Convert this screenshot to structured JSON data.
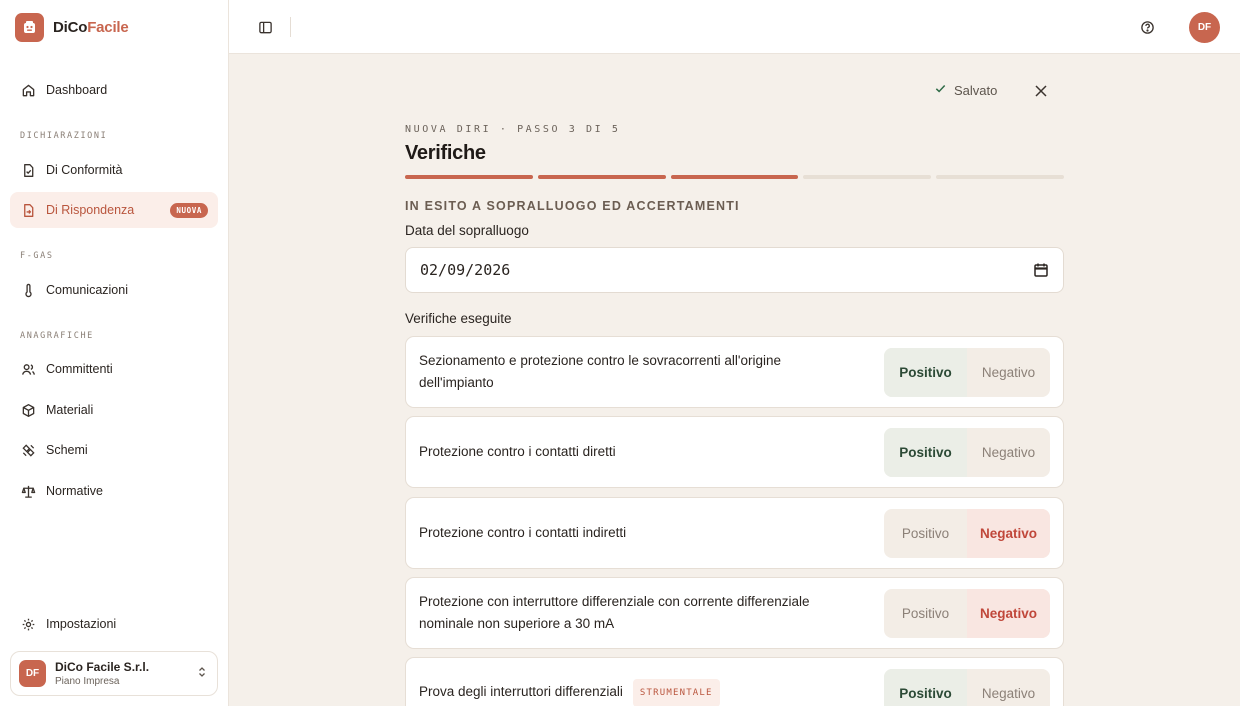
{
  "app": {
    "brand_part1": "DiCo",
    "brand_part2": "Facile",
    "accent_color": "#c8664f"
  },
  "sidebar": {
    "dashboard": {
      "label": "Dashboard",
      "icon": "home-icon"
    },
    "sections": [
      {
        "title": "DICHIARAZIONI",
        "items": [
          {
            "label": "Di Conformità",
            "icon": "document-check-icon"
          },
          {
            "label": "Di Rispondenza",
            "icon": "document-arrow-icon",
            "badge": "NUOVA",
            "active": true
          }
        ]
      },
      {
        "title": "F-GAS",
        "items": [
          {
            "label": "Comunicazioni",
            "icon": "thermometer-icon"
          }
        ]
      },
      {
        "title": "ANAGRAFICHE",
        "items": [
          {
            "label": "Committenti",
            "icon": "users-icon"
          },
          {
            "label": "Materiali",
            "icon": "box-icon"
          },
          {
            "label": "Schemi",
            "icon": "schema-icon"
          },
          {
            "label": "Normative",
            "icon": "scale-icon"
          }
        ]
      }
    ],
    "settings": {
      "label": "Impostazioni",
      "icon": "gear-icon"
    },
    "account": {
      "initials": "DF",
      "name": "DiCo Facile S.r.l.",
      "plan": "Piano Impresa"
    }
  },
  "topbar": {
    "user_initials": "DF"
  },
  "form": {
    "saved_label": "Salvato",
    "step_label": "NUOVA DIRI · PASSO 3 DI 5",
    "title": "Verifiche",
    "steps_total": 5,
    "steps_done": 3,
    "section_title": "IN ESITO A SOPRALLUOGO ED ACCERTAMENTI",
    "date_label": "Data del sopralluogo",
    "date_value": "02/09/2026",
    "checks_label": "Verifiche eseguite",
    "positive_label": "Positivo",
    "negative_label": "Negativo",
    "checks": [
      {
        "text": "Sezionamento e protezione contro le sovracorrenti all'origine dell'impianto",
        "result": "positivo"
      },
      {
        "text": "Protezione contro i contatti diretti",
        "result": "positivo"
      },
      {
        "text": "Protezione contro i contatti indiretti",
        "result": "negativo"
      },
      {
        "text": "Protezione con interruttore differenziale con corrente differenziale nominale non superiore a 30 mA",
        "result": "negativo"
      },
      {
        "text": "Prova degli interruttori differenziali",
        "tag": "STRUMENTALE",
        "result": "positivo"
      }
    ]
  }
}
